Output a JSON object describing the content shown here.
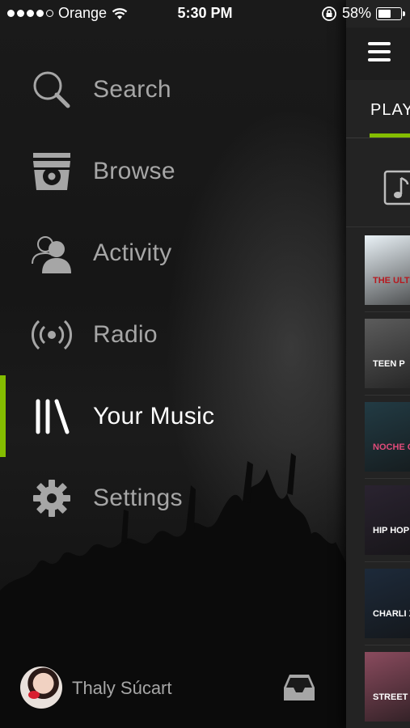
{
  "status_bar": {
    "carrier": "Orange",
    "time": "5:30 PM",
    "battery_percent": "58%",
    "battery_level": 0.58,
    "signal_dots": 5,
    "signal_filled": 4
  },
  "menu": {
    "items": [
      {
        "label": "Search",
        "icon": "search-icon"
      },
      {
        "label": "Browse",
        "icon": "browse-icon"
      },
      {
        "label": "Activity",
        "icon": "activity-icon"
      },
      {
        "label": "Radio",
        "icon": "radio-icon"
      },
      {
        "label": "Your Music",
        "icon": "your-music-icon",
        "active": true
      },
      {
        "label": "Settings",
        "icon": "gear-icon"
      }
    ]
  },
  "user": {
    "name": "Thaly Súcart"
  },
  "panel": {
    "tab_label": "PLAY",
    "thumbnails": [
      {
        "text": "THE ULTIM CHRISTM PLAYLIS",
        "colors": [
          "#eaf2f7",
          "#b7191f"
        ]
      },
      {
        "text": "TEEN P",
        "colors": [
          "#5c5c5c",
          "#ffffff"
        ]
      },
      {
        "text": "NOCHE CHICA",
        "colors": [
          "#223b44",
          "#e24b7a"
        ]
      },
      {
        "text": "HIP HOP PARTY",
        "colors": [
          "#2a2330",
          "#ffffff"
        ]
      },
      {
        "text": "CHARLI XCX",
        "colors": [
          "#1d2a3a",
          "#ffffff"
        ]
      },
      {
        "text": "STREET D",
        "colors": [
          "#8a4b5e",
          "#ffffff"
        ]
      }
    ]
  },
  "colors": {
    "accent": "#84bd00",
    "background": "#141414",
    "menu_text": "#a6a6a6"
  }
}
